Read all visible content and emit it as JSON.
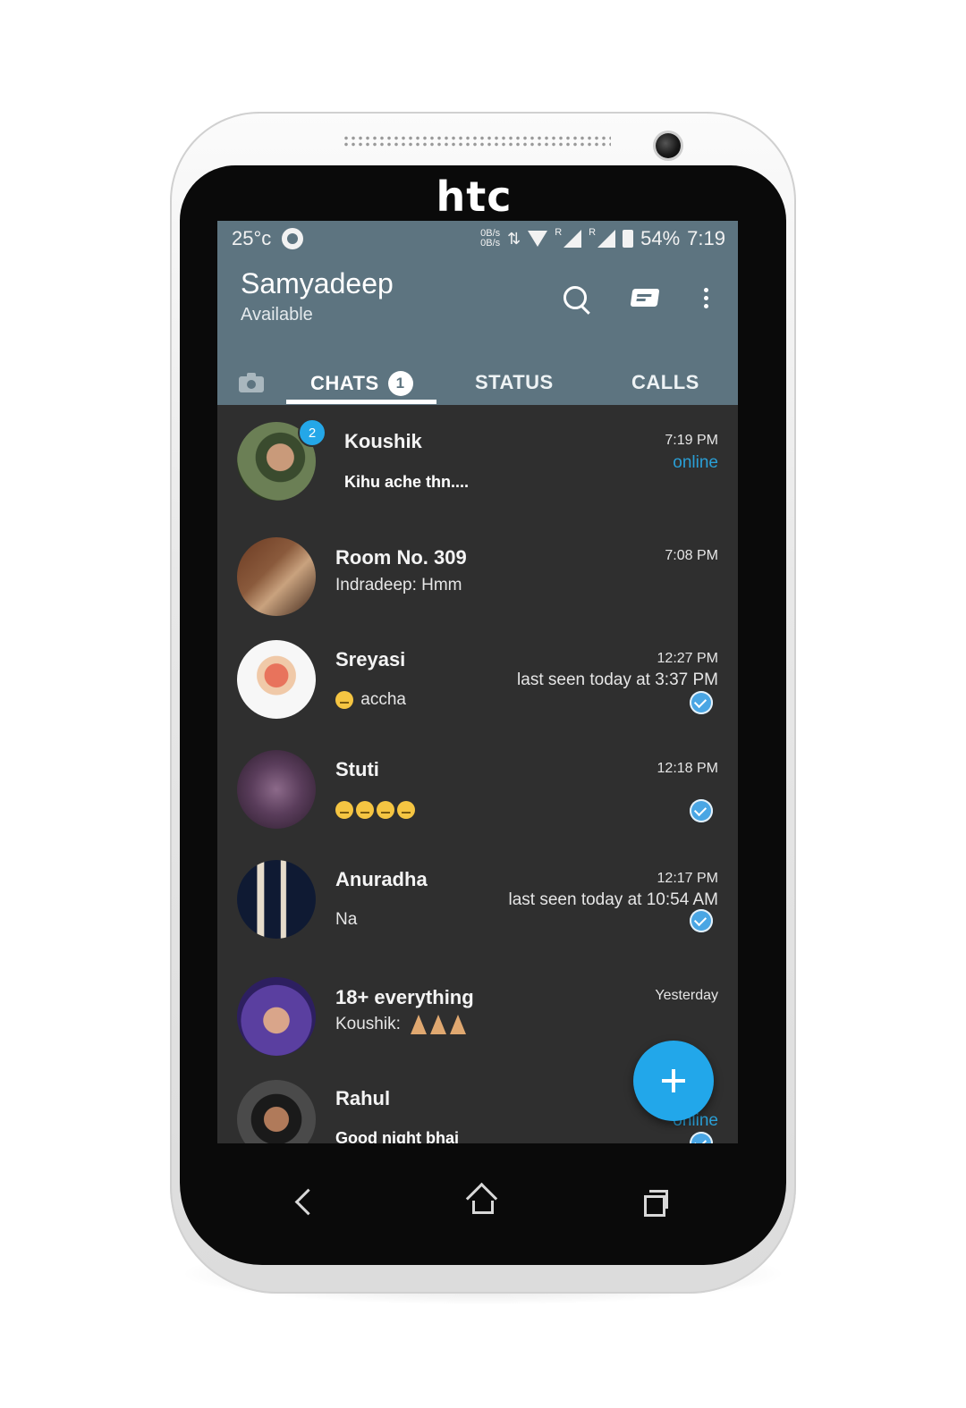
{
  "device": {
    "brand": "htc"
  },
  "status_bar": {
    "temperature": "25°c",
    "net_up": "0B/s",
    "net_down": "0B/s",
    "roaming_1": "R",
    "roaming_2": "R",
    "battery": "54%",
    "time": "7:19"
  },
  "header": {
    "profile_name": "Samyadeep",
    "profile_status": "Available",
    "icons": [
      "search-icon",
      "new-message-icon",
      "more-options-icon"
    ]
  },
  "tabs": {
    "chats_label": "CHATS",
    "chats_badge": "1",
    "status_label": "STATUS",
    "calls_label": "CALLS"
  },
  "chats": [
    {
      "name": "Koushik",
      "preview": "Kihu ache thn....",
      "time": "7:19 PM",
      "presence": "online",
      "unread": "2"
    },
    {
      "name": "Room No. 309",
      "preview": "Indradeep: Hmm",
      "time": "7:08 PM"
    },
    {
      "name": "Sreyasi",
      "preview": "accha",
      "time": "12:27 PM",
      "presence": "last seen today at 3:37 PM"
    },
    {
      "name": "Stuti",
      "preview": "",
      "time": "12:18 PM"
    },
    {
      "name": "Anuradha",
      "preview": "Na",
      "time": "12:17 PM",
      "presence": "last seen today at 10:54 AM"
    },
    {
      "name": "18+ everything",
      "preview": "Koushik:",
      "time": "Yesterday"
    },
    {
      "name": "Rahul",
      "preview": "Good night bhai",
      "presence": "online"
    }
  ],
  "colors": {
    "appbar": "#5d7480",
    "list_bg": "#2f2f2f",
    "accent": "#22a7ea",
    "online": "#2a9fd6"
  }
}
